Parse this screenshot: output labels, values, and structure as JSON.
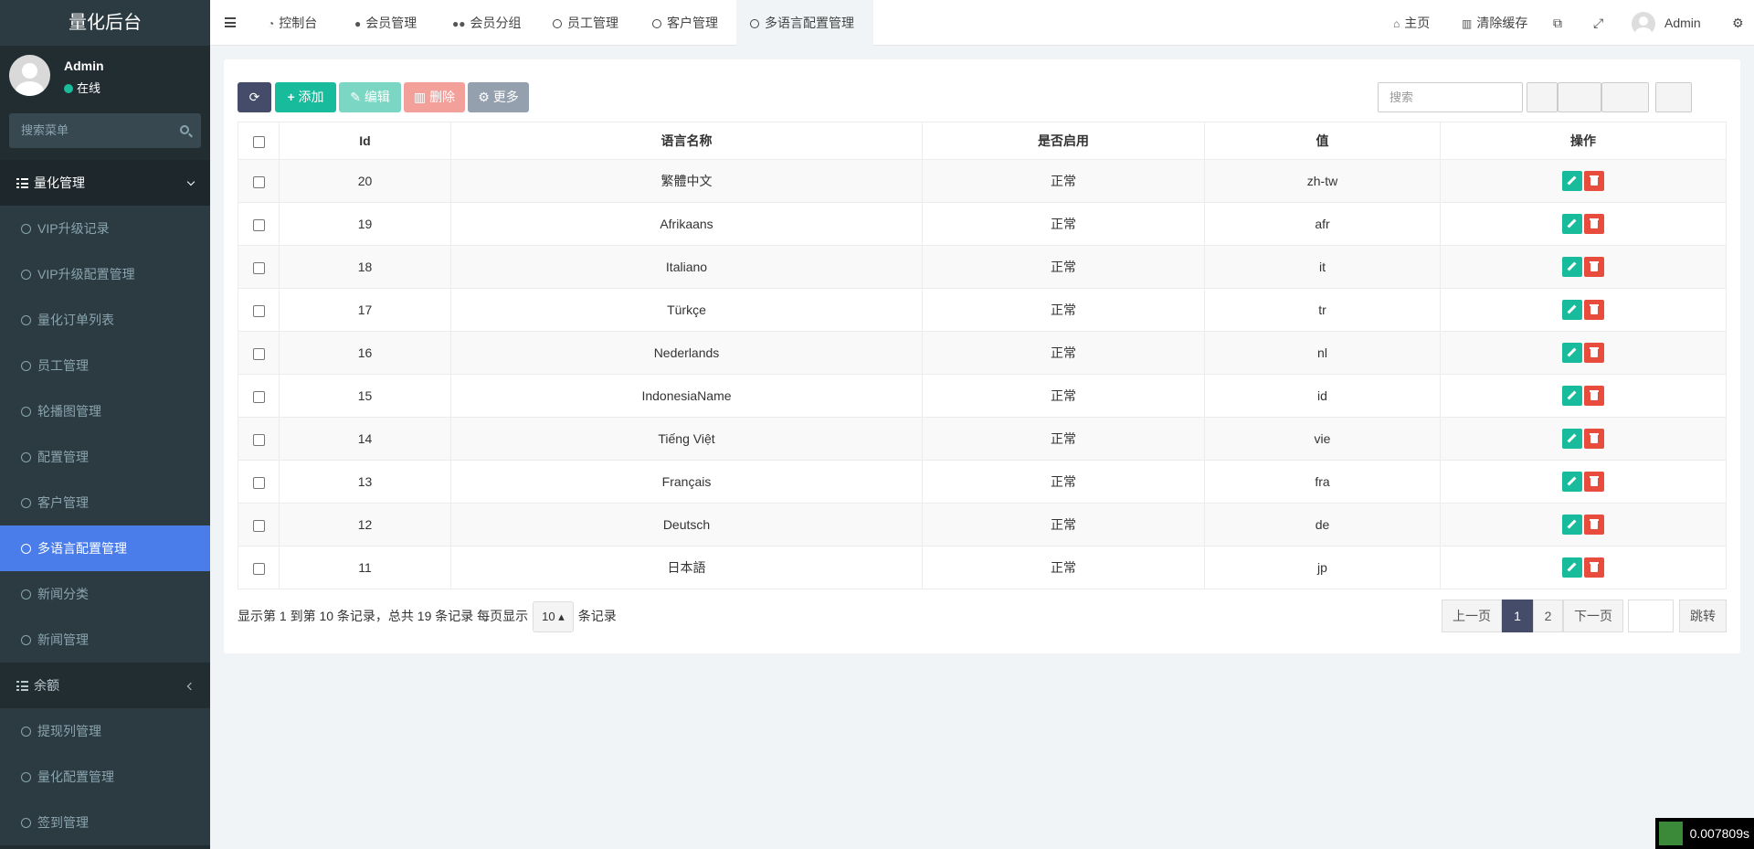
{
  "app": {
    "title": "量化后台"
  },
  "user": {
    "name": "Admin",
    "status": "在线"
  },
  "sidebar": {
    "search_placeholder": "搜索菜单",
    "group1": "量化管理",
    "items1": [
      "VIP升级记录",
      "VIP升级配置管理",
      "量化订单列表",
      "员工管理",
      "轮播图管理",
      "配置管理",
      "客户管理",
      "多语言配置管理",
      "新闻分类",
      "新闻管理"
    ],
    "group2": "余额",
    "items2": [
      "提现列管理",
      "量化配置管理",
      "签到管理"
    ]
  },
  "topbar": {
    "tabs": [
      "控制台",
      "会员管理",
      "会员分组",
      "员工管理",
      "客户管理",
      "多语言配置管理"
    ],
    "home": "主页",
    "clear_cache": "清除缓存",
    "user": "Admin"
  },
  "toolbar": {
    "add": "添加",
    "edit": "编辑",
    "delete": "删除",
    "more": "更多",
    "search_placeholder": "搜索"
  },
  "table": {
    "headers": [
      "Id",
      "语言名称",
      "是否启用",
      "值",
      "操作"
    ],
    "rows": [
      {
        "id": "20",
        "name": "繁體中文",
        "status": "正常",
        "value": "zh-tw"
      },
      {
        "id": "19",
        "name": "Afrikaans",
        "status": "正常",
        "value": "afr"
      },
      {
        "id": "18",
        "name": "Italiano",
        "status": "正常",
        "value": "it"
      },
      {
        "id": "17",
        "name": "Türkçe",
        "status": "正常",
        "value": "tr"
      },
      {
        "id": "16",
        "name": "Nederlands",
        "status": "正常",
        "value": "nl"
      },
      {
        "id": "15",
        "name": "IndonesiaName",
        "status": "正常",
        "value": "id"
      },
      {
        "id": "14",
        "name": "Tiếng Việt",
        "status": "正常",
        "value": "vie"
      },
      {
        "id": "13",
        "name": "Français",
        "status": "正常",
        "value": "fra"
      },
      {
        "id": "12",
        "name": "Deutsch",
        "status": "正常",
        "value": "de"
      },
      {
        "id": "11",
        "name": "日本語",
        "status": "正常",
        "value": "jp"
      }
    ]
  },
  "pagination": {
    "info": "显示第 1 到第 10 条记录，总共 19 条记录 每页显示",
    "page_size": "10",
    "suffix": "条记录",
    "prev": "上一页",
    "pages": [
      "1",
      "2"
    ],
    "next": "下一页",
    "jump": "跳转"
  },
  "perf": {
    "time": "0.007809s"
  },
  "colors": {
    "sidebar": "#222d32",
    "active": "#4a7dea",
    "success": "#18bc9c",
    "danger": "#e74c3c",
    "primary": "#444c69"
  }
}
